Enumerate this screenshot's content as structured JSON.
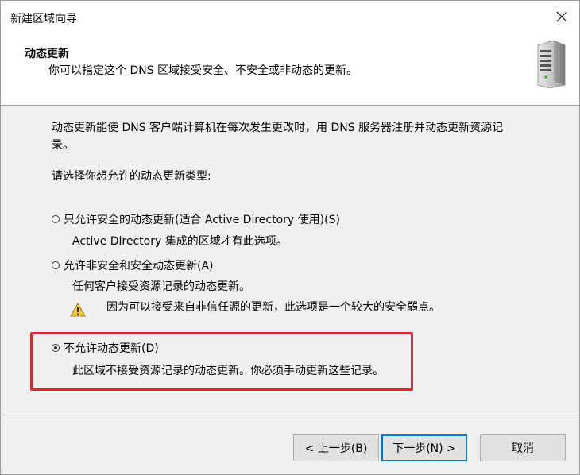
{
  "window": {
    "title": "新建区域向导"
  },
  "header": {
    "title": "动态更新",
    "subtitle": "你可以指定这个 DNS 区域接受安全、不安全或非动态的更新。"
  },
  "content": {
    "intro_line1": "动态更新能使 DNS 客户端计算机在每次发生更改时，用 DNS 服务器注册并动态更新资源记",
    "intro_line2": "录。",
    "prompt": "请选择你想允许的动态更新类型:",
    "options": [
      {
        "label": "只允许安全的动态更新(适合 Active Directory 使用)(S)",
        "description": "Active Directory 集成的区域才有此选项。",
        "selected": false
      },
      {
        "label": "允许非安全和安全动态更新(A)",
        "description": "任何客户接受资源记录的动态更新。",
        "warning": "因为可以接受来自非信任源的更新，此选项是一个较大的安全弱点。",
        "selected": false
      },
      {
        "label": "不允许动态更新(D)",
        "description": "此区域不接受资源记录的动态更新。你必须手动更新这些记录。",
        "selected": true
      }
    ]
  },
  "buttons": {
    "back": "< 上一步(B)",
    "next": "下一步(N) >",
    "cancel": "取消"
  },
  "colors": {
    "highlight_border": "#e0282e",
    "default_button_border": "#0078d7"
  }
}
